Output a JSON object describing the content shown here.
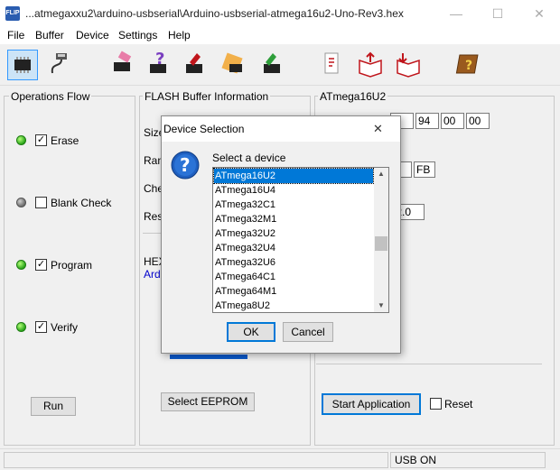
{
  "window": {
    "title": "...atmegaxxu2\\arduino-usbserial\\Arduino-usbserial-atmega16u2-Uno-Rev3.hex",
    "icon_text": "FLIP",
    "minimize": "—",
    "maximize": "☐",
    "close": "✕"
  },
  "menu": {
    "file": "File",
    "buffer": "Buffer",
    "device": "Device",
    "settings": "Settings",
    "help": "Help"
  },
  "toolbar": {
    "icons": [
      "chip-select-icon",
      "usb-cable-icon",
      "erase-chip-icon",
      "blank-check-icon",
      "program-chip-icon",
      "verify-chip-icon",
      "upload-chip-icon",
      "load-hex-icon",
      "save-book-icon",
      "read-book-icon",
      "help-book-icon"
    ]
  },
  "operations": {
    "title": "Operations Flow",
    "erase": "Erase",
    "blank_check": "Blank Check",
    "program": "Program",
    "verify": "Verify",
    "run": "Run"
  },
  "flash": {
    "title": "FLASH Buffer Information",
    "size_label": "Size",
    "range_label": "Ran",
    "checksum_label": "Che",
    "reset_label": "Res",
    "hex_label": "HEX",
    "hex_value": "Ard",
    "select_eeprom": "Select EEPROM"
  },
  "device_panel": {
    "title": "ATmega16U2",
    "sig1": "E",
    "sig2": "94",
    "sig3": "00",
    "sig4": "00",
    "id1": "C",
    "id2": "FB",
    "version": ".2.0",
    "start_application": "Start Application",
    "reset": "Reset"
  },
  "dialog": {
    "title": "Device Selection",
    "close": "✕",
    "prompt": "Select a device",
    "devices": [
      "ATmega16U2",
      "ATmega16U4",
      "ATmega32C1",
      "ATmega32M1",
      "ATmega32U2",
      "ATmega32U4",
      "ATmega32U6",
      "ATmega64C1",
      "ATmega64M1",
      "ATmega8U2"
    ],
    "selected": "ATmega16U2",
    "ok": "OK",
    "cancel": "Cancel",
    "scroll_up": "▲",
    "scroll_down": "▼"
  },
  "statusbar": {
    "usb": "USB ON"
  }
}
